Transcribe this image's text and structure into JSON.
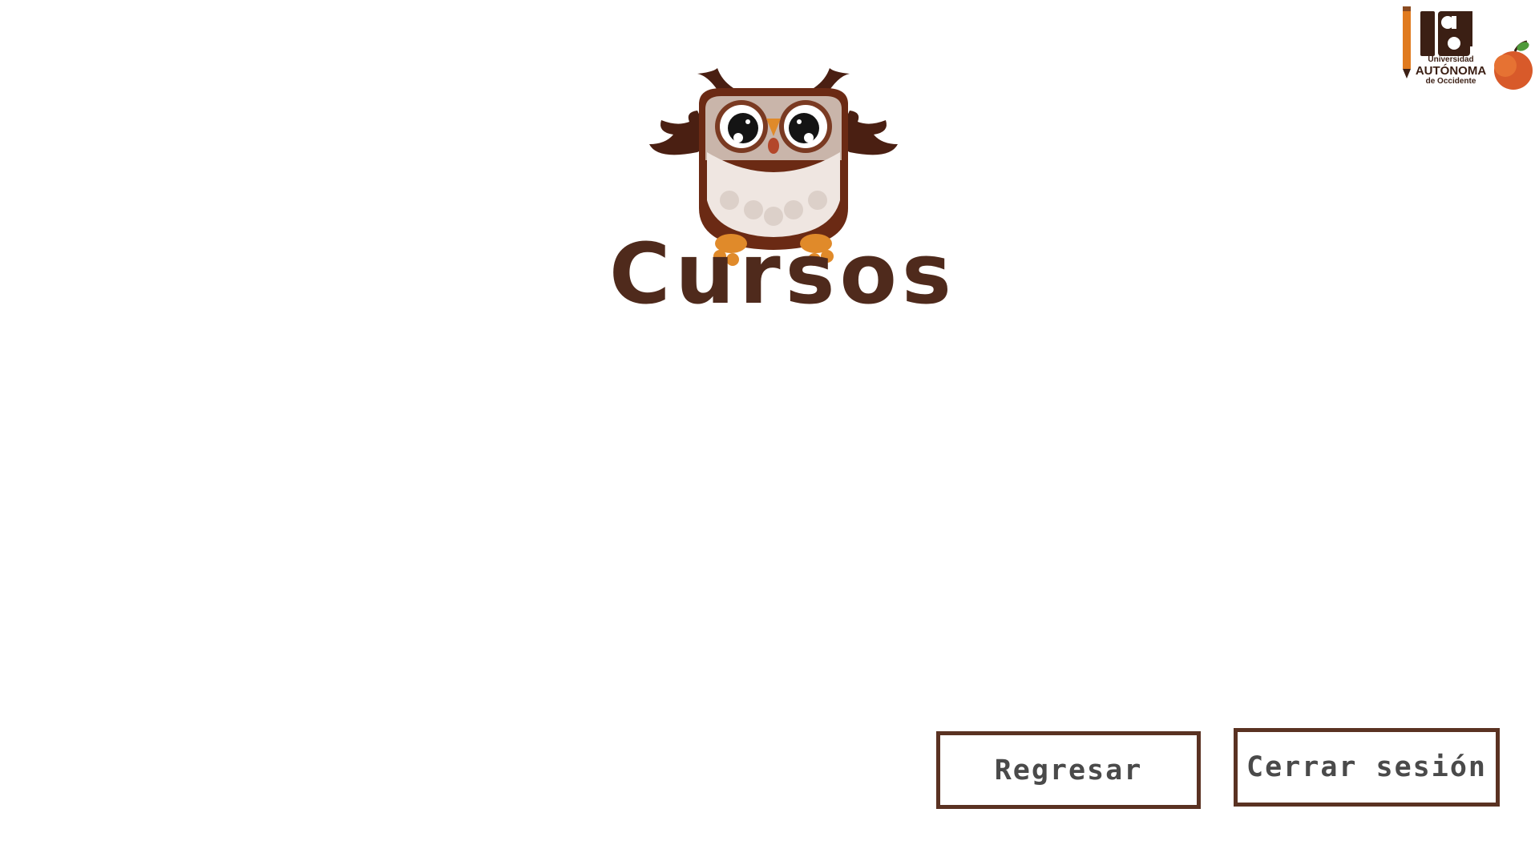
{
  "page": {
    "title": "Cursos"
  },
  "logo": {
    "line1": "Universidad",
    "line2": "AUTÓNOMA",
    "line3": "de Occidente"
  },
  "actions": {
    "back_label": "Regresar",
    "logout_label": "Cerrar sesión"
  },
  "icons": {
    "mascot": "owl-mascot-icon",
    "logo": "university-logo-icon"
  },
  "colors": {
    "brand_brown": "#4f2a1c",
    "button_border": "#5a3222",
    "button_text": "#4a4a4a",
    "background": "#ffffff"
  }
}
